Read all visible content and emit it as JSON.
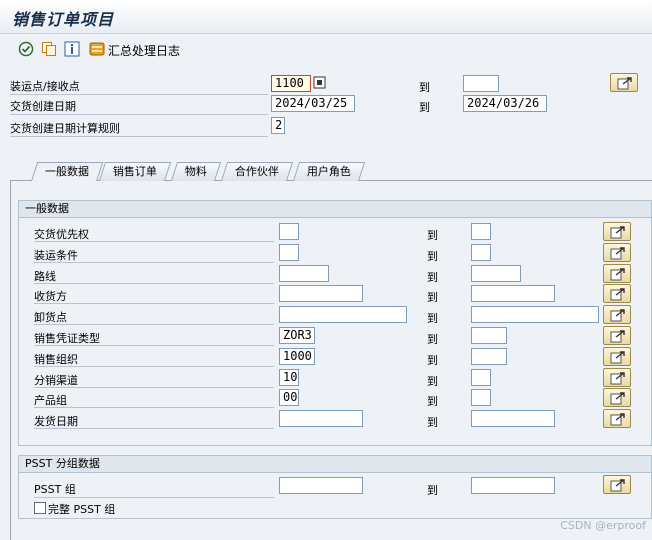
{
  "title": "销售订单项目",
  "toolbar": {
    "log_label": "汇总处理日志"
  },
  "header": {
    "shipping_point_label": "装运点/接收点",
    "shipping_point_value": "1100",
    "shipping_point_to": "",
    "delivery_date_label": "交货创建日期",
    "delivery_date_from": "2024/03/25",
    "delivery_date_to": "2024/03/26",
    "calc_rule_label": "交货创建日期计算规则",
    "calc_rule_value": "2",
    "to_label": "到"
  },
  "tabs": [
    "一般数据",
    "销售订单",
    "物料",
    "合作伙伴",
    "用户角色"
  ],
  "general": {
    "heading": "一般数据",
    "rows": [
      {
        "label": "交货优先权",
        "from": "",
        "to": ""
      },
      {
        "label": "装运条件",
        "from": "",
        "to": ""
      },
      {
        "label": "路线",
        "from": "",
        "to": ""
      },
      {
        "label": "收货方",
        "from": "",
        "to": ""
      },
      {
        "label": "卸货点",
        "from": "",
        "to": ""
      },
      {
        "label": "销售凭证类型",
        "from": "ZOR3",
        "to": ""
      },
      {
        "label": "销售组织",
        "from": "1000",
        "to": ""
      },
      {
        "label": "分销渠道",
        "from": "10",
        "to": ""
      },
      {
        "label": "产品组",
        "from": "00",
        "to": ""
      },
      {
        "label": "发货日期",
        "from": "",
        "to": ""
      }
    ]
  },
  "psst": {
    "heading": "PSST 分组数据",
    "group_label": "PSST 组",
    "group_from": "",
    "group_to": "",
    "complete_label": "完整 PSST 组",
    "complete_checked": false
  },
  "watermark": "CSDN @erproof",
  "icons": [
    "execute-icon",
    "copy-icon",
    "info-icon",
    "log-icon",
    "multiple-selection-icon",
    "matchcode-icon"
  ]
}
